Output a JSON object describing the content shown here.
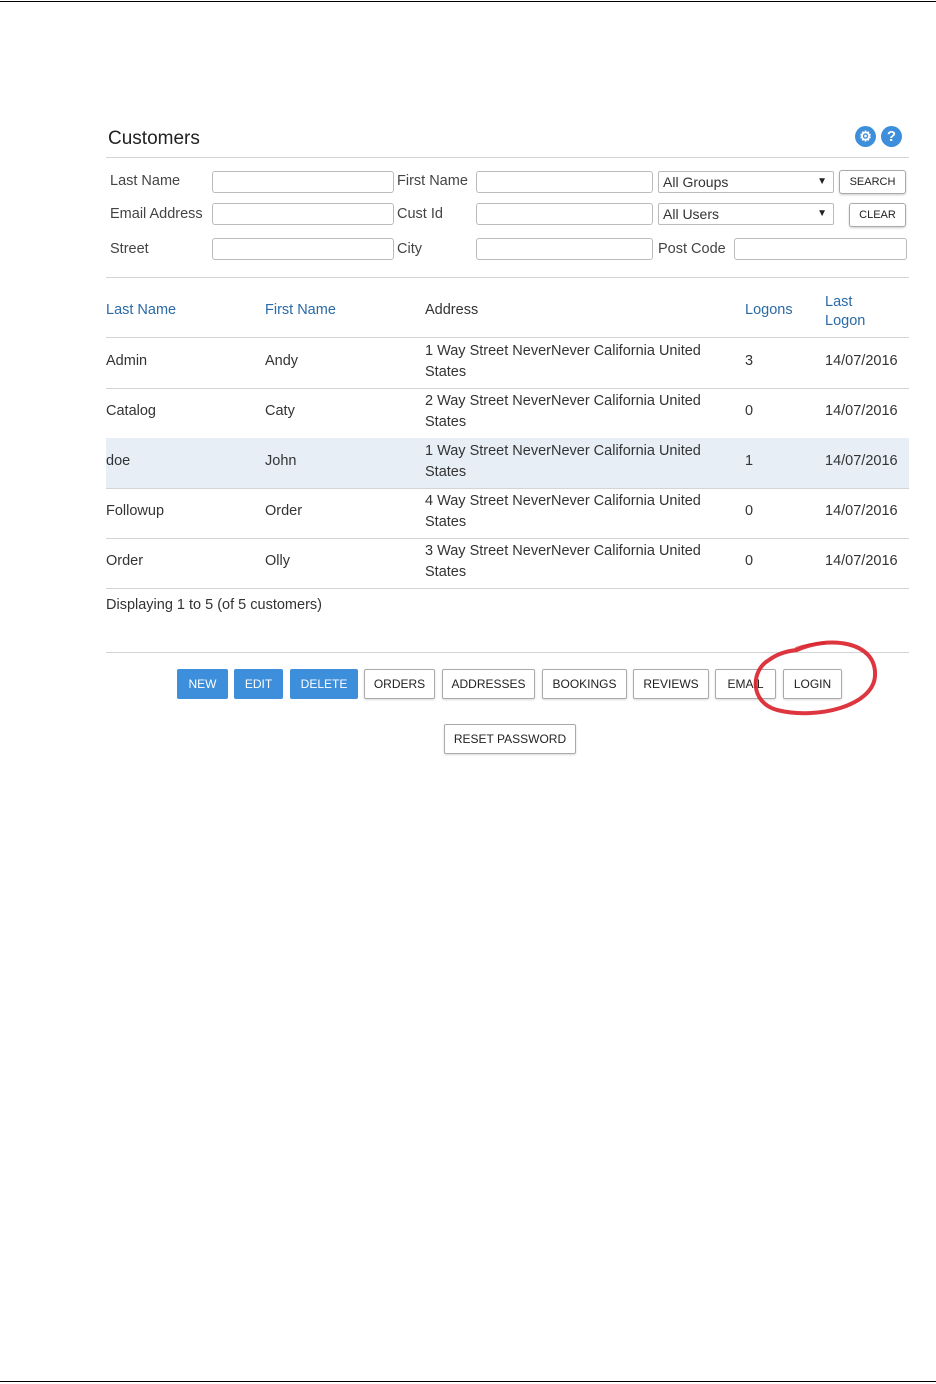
{
  "panel": {
    "title": "Customers"
  },
  "icons": {
    "settings": "gear-icon",
    "help": "?"
  },
  "filters": {
    "last_name_label": "Last Name",
    "first_name_label": "First Name",
    "email_label": "Email Address",
    "cust_id_label": "Cust Id",
    "street_label": "Street",
    "city_label": "City",
    "post_code_label": "Post Code",
    "groups_select": "All Groups",
    "users_select": "All Users",
    "search_label": "SEARCH",
    "clear_label": "CLEAR"
  },
  "table": {
    "headers": [
      "Last Name",
      "First Name",
      "Address",
      "Logons",
      "Last Logon"
    ],
    "rows": [
      {
        "last": "Admin",
        "first": "Andy",
        "address": "1 Way Street NeverNever California United States",
        "logons": "3",
        "last_logon": "14/07/2016"
      },
      {
        "last": "Catalog",
        "first": "Caty",
        "address": "2 Way Street NeverNever California United States",
        "logons": "0",
        "last_logon": "14/07/2016"
      },
      {
        "last": "doe",
        "first": "John",
        "address": "1 Way Street NeverNever California United States",
        "logons": "1",
        "last_logon": "14/07/2016"
      },
      {
        "last": "Followup",
        "first": "Order",
        "address": "4 Way Street NeverNever California United States",
        "logons": "0",
        "last_logon": "14/07/2016"
      },
      {
        "last": "Order",
        "first": "Olly",
        "address": "3 Way Street NeverNever California United States",
        "logons": "0",
        "last_logon": "14/07/2016"
      }
    ],
    "selected_row": 2
  },
  "footer": {
    "display_text": "Displaying 1 to 5 (of 5 customers)"
  },
  "actions": {
    "new": "NEW",
    "edit": "EDIT",
    "delete": "DELETE",
    "orders": "ORDERS",
    "addresses": "ADDRESSES",
    "bookings": "BOOKINGS",
    "reviews": "REVIEWS",
    "email": "EMAIL",
    "login": "LOGIN",
    "reset_password": "RESET PASSWORD"
  },
  "colors": {
    "accent": "#3d8fdb",
    "link": "#2a6aa7",
    "highlight_circle": "#d9202a",
    "selected_row": "#e7eef6"
  }
}
